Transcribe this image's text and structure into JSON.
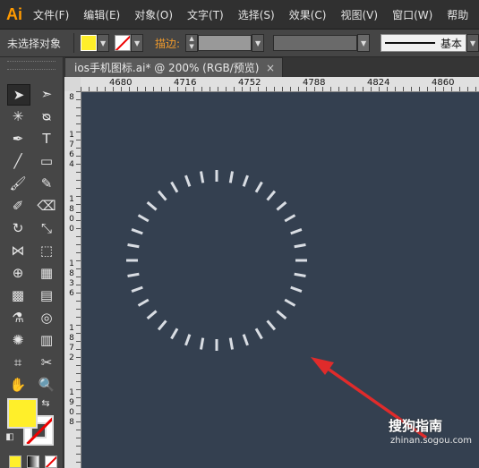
{
  "app": {
    "logo": "Ai"
  },
  "menu": [
    "文件(F)",
    "编辑(E)",
    "对象(O)",
    "文字(T)",
    "选择(S)",
    "效果(C)",
    "视图(V)",
    "窗口(W)",
    "帮助"
  ],
  "control_bar": {
    "selection_label": "未选择对象",
    "stroke_label": "描边:",
    "brush_label": "基本"
  },
  "document_tab": {
    "title": "ios手机图标.ai* @ 200% (RGB/预览)",
    "close": "×"
  },
  "rulers": {
    "horizontal": [
      "4680",
      "4716",
      "4752",
      "4788",
      "4824",
      "4860"
    ],
    "vertical": [
      "8",
      "1\n7\n6\n4",
      "1\n8\n0\n0",
      "1\n8\n3\n6",
      "1\n8\n7\n2",
      "1\n9\n0\n8"
    ]
  },
  "artwork": {
    "tick_count": 36,
    "tick_color": "#d9dde3"
  },
  "colors": {
    "fill": "#ffef2a",
    "canvas": "#344050",
    "arrow": "#e02b2b"
  },
  "watermark": {
    "main": "搜狗指南",
    "sub": "zhinan.sogou.com"
  }
}
